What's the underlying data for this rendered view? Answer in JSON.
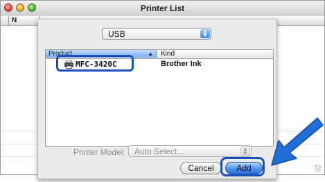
{
  "window": {
    "title": "Printer List"
  },
  "background_list": {
    "columns": [
      "",
      "N"
    ]
  },
  "sheet": {
    "connection_popup": {
      "value": "USB"
    },
    "table": {
      "columns": [
        {
          "label": "Product"
        },
        {
          "label": "Kind"
        }
      ],
      "rows": [
        {
          "product": "MFC-3420C",
          "kind": "Brother Ink"
        }
      ]
    },
    "printer_model": {
      "label": "Printer Model:",
      "value": "Auto Select..."
    },
    "buttons": {
      "cancel": "Cancel",
      "add": "Add"
    }
  },
  "colors": {
    "highlight": "#1d4fbf",
    "arrow": "#1f6fd6"
  },
  "icons": {
    "row_icon": "printer-icon",
    "pointer": "arrow-pointer"
  }
}
